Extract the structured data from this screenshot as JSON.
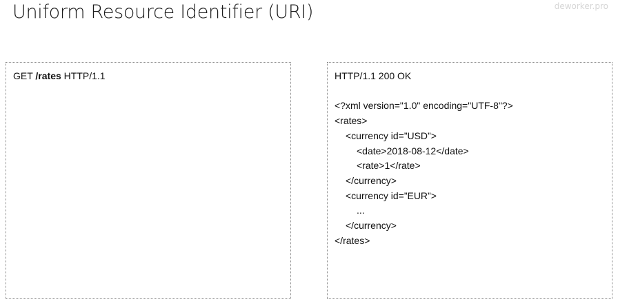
{
  "header": {
    "title": "Uniform Resource Identifier (URI)",
    "watermark": "deworker.pro"
  },
  "request": {
    "method": "GET",
    "path": "/rates",
    "protocol": "HTTP/1.1"
  },
  "response": {
    "status_line": "HTTP/1.1 200 OK",
    "lines": [
      "<?xml version=\"1.0\" encoding=\"UTF-8\"?>",
      "<rates>",
      "<currency id=”USD”>",
      "<date>2018-08-12</date>",
      "<rate>1</rate>",
      "</currency>",
      "<currency id=”EUR”>",
      "...",
      "</currency>",
      "</rates>"
    ]
  }
}
